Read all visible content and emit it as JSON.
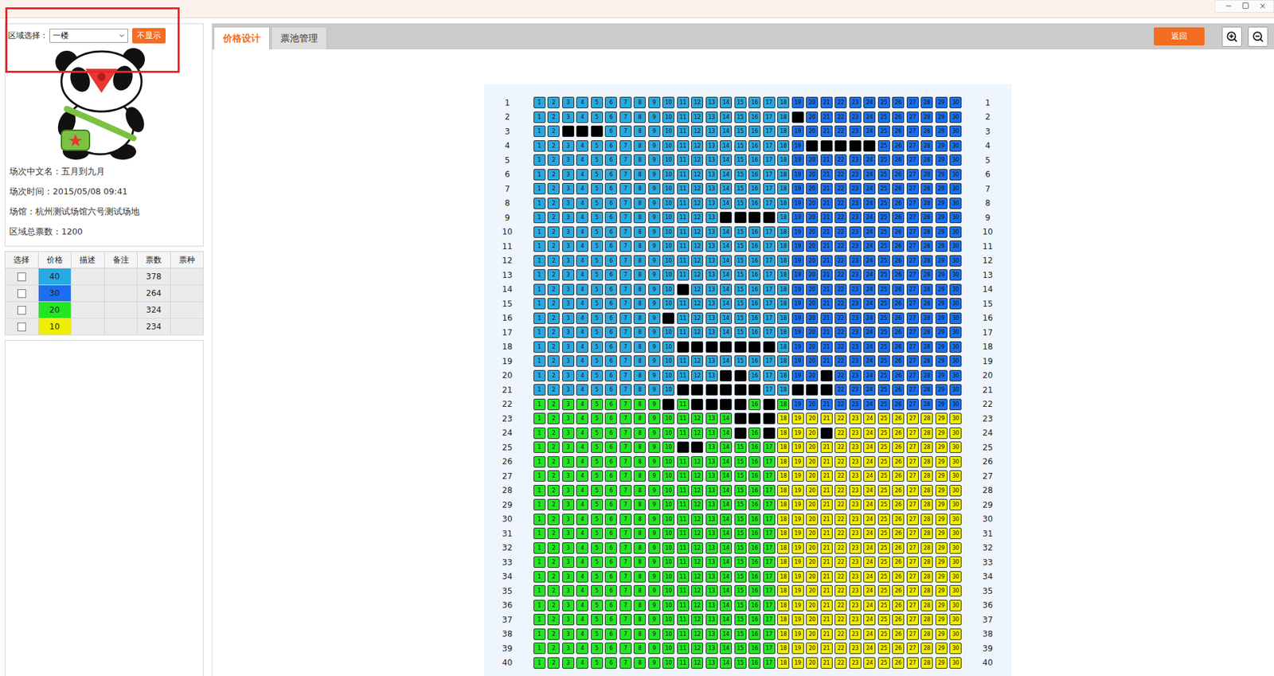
{
  "region": {
    "label": "区域选择：",
    "value": "一楼",
    "toggle": "不显示"
  },
  "info": [
    "场次中文名：五月到九月",
    "场次时间：2015/05/08 09:41",
    "场馆：杭州测试场馆六号测试场地",
    "区域总票数：1200"
  ],
  "price_table": {
    "columns": [
      "选择",
      "价格",
      "描述",
      "备注",
      "票数",
      "票种"
    ],
    "rows": [
      {
        "code": "a",
        "price": "40",
        "description": "",
        "remark": "",
        "count": "378",
        "ticket_type": "",
        "checked": false,
        "color": "#27a9e1"
      },
      {
        "code": "b",
        "price": "30",
        "description": "",
        "remark": "",
        "count": "264",
        "ticket_type": "",
        "checked": false,
        "color": "#1a6ff0"
      },
      {
        "code": "c",
        "price": "20",
        "description": "",
        "remark": "",
        "count": "324",
        "ticket_type": "",
        "checked": false,
        "color": "#22e622"
      },
      {
        "code": "d",
        "price": "10",
        "description": "",
        "remark": "",
        "count": "234",
        "ticket_type": "",
        "checked": false,
        "color": "#eeee00"
      }
    ]
  },
  "tabs": [
    {
      "label": "价格设计",
      "selected": true
    },
    {
      "label": "票池管理",
      "selected": false
    }
  ],
  "back_button": "返回",
  "seat_numbers": [
    "1",
    "2",
    "3",
    "4",
    "5",
    "6",
    "7",
    "8",
    "9",
    "10",
    "11",
    "12",
    "13",
    "14",
    "15",
    "16",
    "17",
    "18",
    "19",
    "20",
    "21",
    "22",
    "23",
    "24",
    "25",
    "26",
    "27",
    "28",
    "29",
    "30"
  ],
  "rows": [
    {
      "label": "1",
      "tiers": "aaaaaaaaaaaaaaaaaabbbbbbbbbbbb",
      "blocked": []
    },
    {
      "label": "2",
      "tiers": "aaaaaaaaaaaaaaaaaabbbbbbbbbbbb",
      "blocked": [
        "19"
      ]
    },
    {
      "label": "3",
      "tiers": "aaaaaaaaaaaaaaaaaabbbbbbbbbbbb",
      "blocked": [
        "3",
        "4",
        "5"
      ]
    },
    {
      "label": "4",
      "tiers": "aaaaaaaaaaaaaaaaaabbbbbbbbbbbb",
      "blocked": [
        "20",
        "21",
        "22",
        "23",
        "24"
      ]
    },
    {
      "label": "5",
      "tiers": "aaaaaaaaaaaaaaaaaabbbbbbbbbbbb",
      "blocked": []
    },
    {
      "label": "6",
      "tiers": "aaaaaaaaaaaaaaaaaabbbbbbbbbbbb",
      "blocked": []
    },
    {
      "label": "7",
      "tiers": "aaaaaaaaaaaaaaaaaabbbbbbbbbbbb",
      "blocked": []
    },
    {
      "label": "8",
      "tiers": "aaaaaaaaaaaaaaaaaabbbbbbbbbbbb",
      "blocked": []
    },
    {
      "label": "9",
      "tiers": "aaaaaaaaaaaaaaaaaabbbbbbbbbbbb",
      "blocked": [
        "14",
        "15",
        "16",
        "17"
      ]
    },
    {
      "label": "10",
      "tiers": "aaaaaaaaaaaaaaaaaabbbbbbbbbbbb",
      "blocked": []
    },
    {
      "label": "11",
      "tiers": "aaaaaaaaaaaaaaaaaabbbbbbbbbbbb",
      "blocked": []
    },
    {
      "label": "12",
      "tiers": "aaaaaaaaaaaaaaaaaabbbbbbbbbbbb",
      "blocked": []
    },
    {
      "label": "13",
      "tiers": "aaaaaaaaaaaaaaaaaabbbbbbbbbbbb",
      "blocked": []
    },
    {
      "label": "14",
      "tiers": "aaaaaaaaaaaaaaaaaabbbbbbbbbbbb",
      "blocked": [
        "11"
      ]
    },
    {
      "label": "15",
      "tiers": "aaaaaaaaaaaaaaaaaabbbbbbbbbbbb",
      "blocked": []
    },
    {
      "label": "16",
      "tiers": "aaaaaaaaaaaaaaaaaabbbbbbbbbbbb",
      "blocked": [
        "10"
      ]
    },
    {
      "label": "17",
      "tiers": "aaaaaaaaaaaaaaaaaabbbbbbbbbbbb",
      "blocked": []
    },
    {
      "label": "18",
      "tiers": "aaaaaaaaaaaaaaaaaabbbbbbbbbbbb",
      "blocked": [
        "11",
        "12",
        "13",
        "14",
        "15",
        "16",
        "17"
      ]
    },
    {
      "label": "19",
      "tiers": "aaaaaaaaaaaaaaaaaabbbbbbbbbbbb",
      "blocked": []
    },
    {
      "label": "20",
      "tiers": "aaaaaaaaaaaaaaaaaabbbbbbbbbbbb",
      "blocked": [
        "14",
        "15",
        "21"
      ]
    },
    {
      "label": "21",
      "tiers": "aaaaaaaaaaaaaaaaaabbbbbbbbbbbb",
      "blocked": [
        "11",
        "12",
        "13",
        "14",
        "15",
        "16",
        "19",
        "20",
        "21"
      ]
    },
    {
      "label": "22",
      "tiers": "ccccccccccccccccccbbbbbbbbbbbb",
      "blocked": [
        "10",
        "12",
        "13",
        "14",
        "15",
        "17"
      ]
    },
    {
      "label": "23",
      "tiers": "cccccccccccccccccddddddddddddd",
      "blocked": [
        "15",
        "16",
        "17"
      ]
    },
    {
      "label": "24",
      "tiers": "cccccccccccccccccddddddddddddd",
      "blocked": [
        "15",
        "17",
        "21"
      ]
    },
    {
      "label": "25",
      "tiers": "cccccccccccccccccddddddddddddd",
      "blocked": [
        "11",
        "12"
      ]
    },
    {
      "label": "26",
      "tiers": "cccccccccccccccccddddddddddddd",
      "blocked": []
    },
    {
      "label": "27",
      "tiers": "cccccccccccccccccddddddddddddd",
      "blocked": []
    },
    {
      "label": "28",
      "tiers": "cccccccccccccccccddddddddddddd",
      "blocked": []
    },
    {
      "label": "29",
      "tiers": "cccccccccccccccccddddddddddddd",
      "blocked": []
    },
    {
      "label": "30",
      "tiers": "cccccccccccccccccddddddddddddd",
      "blocked": []
    },
    {
      "label": "31",
      "tiers": "cccccccccccccccccddddddddddddd",
      "blocked": []
    },
    {
      "label": "32",
      "tiers": "cccccccccccccccccddddddddddddd",
      "blocked": []
    },
    {
      "label": "33",
      "tiers": "cccccccccccccccccddddddddddddd",
      "blocked": []
    },
    {
      "label": "34",
      "tiers": "cccccccccccccccccddddddddddddd",
      "blocked": []
    },
    {
      "label": "35",
      "tiers": "cccccccccccccccccddddddddddddd",
      "blocked": []
    },
    {
      "label": "36",
      "tiers": "cccccccccccccccccddddddddddddd",
      "blocked": []
    },
    {
      "label": "37",
      "tiers": "cccccccccccccccccddddddddddddd",
      "blocked": []
    },
    {
      "label": "38",
      "tiers": "cccccccccccccccccddddddddddddd",
      "blocked": []
    },
    {
      "label": "39",
      "tiers": "cccccccccccccccccddddddddddddd",
      "blocked": []
    },
    {
      "label": "40",
      "tiers": "cccccccccccccccccddddddddddddd",
      "blocked": []
    }
  ]
}
